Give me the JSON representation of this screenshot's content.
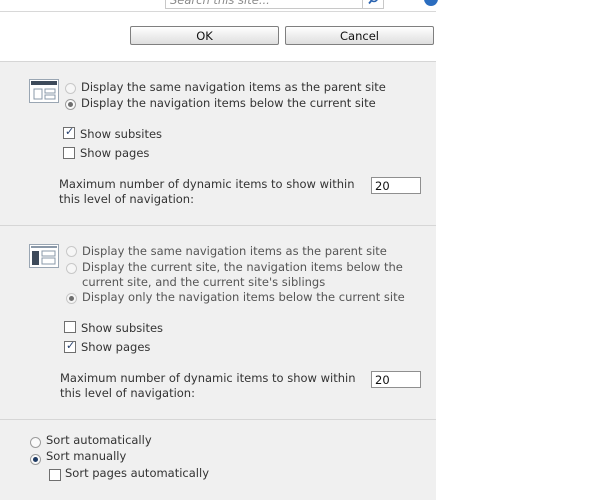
{
  "header": {
    "search_placeholder": "Search this site..."
  },
  "dialog": {
    "ok_label": "OK",
    "cancel_label": "Cancel"
  },
  "global_nav": {
    "options": [
      "Display the same navigation items as the parent site",
      "Display the navigation items below the current site"
    ],
    "show_subsites": "Show subsites",
    "show_pages": "Show pages",
    "max_label_1": "Maximum number of dynamic items to show within",
    "max_label_2": "this level of navigation:",
    "max_value": "20"
  },
  "current_nav": {
    "options": [
      "Display the same navigation items as the parent site",
      "Display the current site, the navigation items below the",
      "current site, and the current site's siblings",
      "Display only the navigation items below the current site"
    ],
    "show_subsites": "Show subsites",
    "show_pages": "Show pages",
    "max_label_1": "Maximum number of dynamic items to show within",
    "max_label_2": "this level of navigation:",
    "max_value": "20"
  },
  "sorting": {
    "sort_auto": "Sort automatically",
    "sort_manual": "Sort manually",
    "sort_pages_auto": "Sort pages automatically"
  }
}
